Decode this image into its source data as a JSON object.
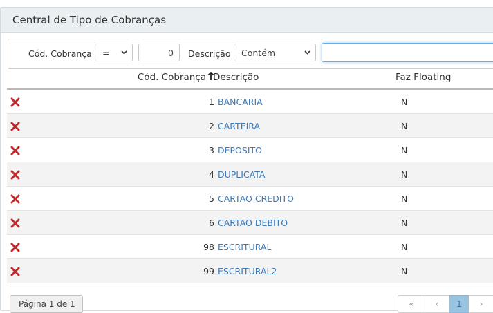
{
  "panel": {
    "title": "Central de Tipo de Cobranças"
  },
  "filter": {
    "code_label": "Cód. Cobrança",
    "operator": "=",
    "code_value": "0",
    "desc_label": "Descrição",
    "desc_operator": "Contém",
    "desc_value": ""
  },
  "table": {
    "columns": {
      "code": "Cód. Cobrança",
      "desc": "Descrição",
      "floating": "Faz Floating"
    },
    "rows": [
      {
        "code": "1",
        "desc": "BANCARIA",
        "floating": "N"
      },
      {
        "code": "2",
        "desc": "CARTEIRA",
        "floating": "N"
      },
      {
        "code": "3",
        "desc": "DEPOSITO",
        "floating": "N"
      },
      {
        "code": "4",
        "desc": "DUPLICATA",
        "floating": "N"
      },
      {
        "code": "5",
        "desc": "CARTAO CREDITO",
        "floating": "N"
      },
      {
        "code": "6",
        "desc": "CARTAO DEBITO",
        "floating": "N"
      },
      {
        "code": "98",
        "desc": "ESCRITURAL",
        "floating": "N"
      },
      {
        "code": "99",
        "desc": "ESCRITURAL2",
        "floating": "N"
      }
    ]
  },
  "pagination": {
    "info": "Página 1 de 1",
    "first": "«",
    "prev": "‹",
    "current": "1",
    "next": "›"
  },
  "icons": {
    "delete": "delete-x-icon",
    "sort": "sort-up-arrow-icon",
    "chevron": "chevron-down-icon"
  },
  "colors": {
    "delete": "#c0282c",
    "link": "#3a7ab8",
    "heading_bg": "#eaeff2",
    "focus": "#66afe9",
    "active_page": "#9ac3e2"
  }
}
